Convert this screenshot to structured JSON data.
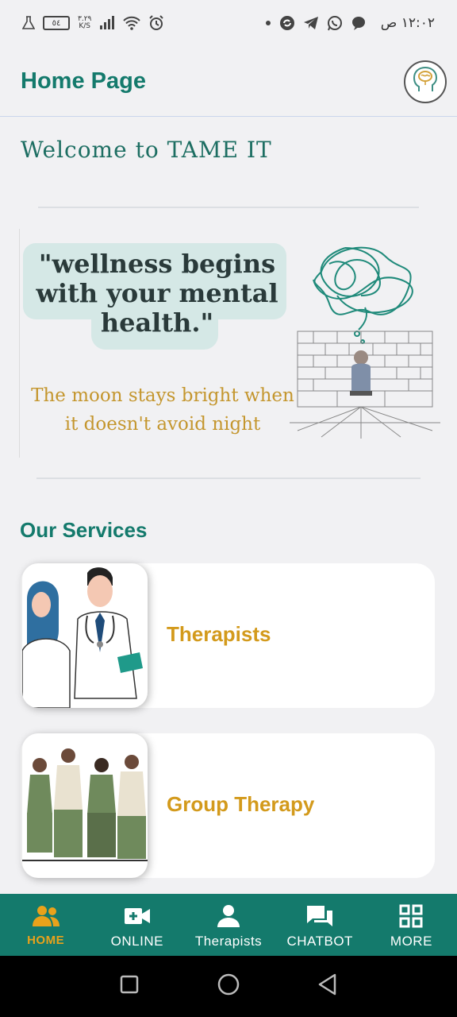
{
  "status_bar": {
    "battery_level": "٥٤",
    "net_speed_value": "٣.٢٩",
    "net_speed_unit": "K/S",
    "time": "١٢:٠٢ ص"
  },
  "header": {
    "title": "Home Page",
    "avatar_icon": "brain-head-icon"
  },
  "welcome_text": "Welcome to TAME IT",
  "banner": {
    "quote": "\"wellness begins with your mental health.\"",
    "subquote": "The moon stays bright when it doesn't avoid night"
  },
  "services": {
    "title": "Our Services",
    "items": [
      {
        "label": "Therapists",
        "image": "doctors-illustration"
      },
      {
        "label": "Group Therapy",
        "image": "group-therapy-illustration"
      }
    ]
  },
  "bottom_nav": {
    "active_color": "#e9a21b",
    "items": [
      {
        "label": "HOME",
        "icon": "people-icon"
      },
      {
        "label": "ONLINE",
        "icon": "video-add-icon"
      },
      {
        "label": "Therapists",
        "icon": "person-icon"
      },
      {
        "label": "CHATBOT",
        "icon": "chat-icon"
      },
      {
        "label": "MORE",
        "icon": "grid-icon"
      }
    ]
  },
  "colors": {
    "brand": "#147a6c",
    "accent": "#d39a1c",
    "background": "#f1f1f3"
  }
}
